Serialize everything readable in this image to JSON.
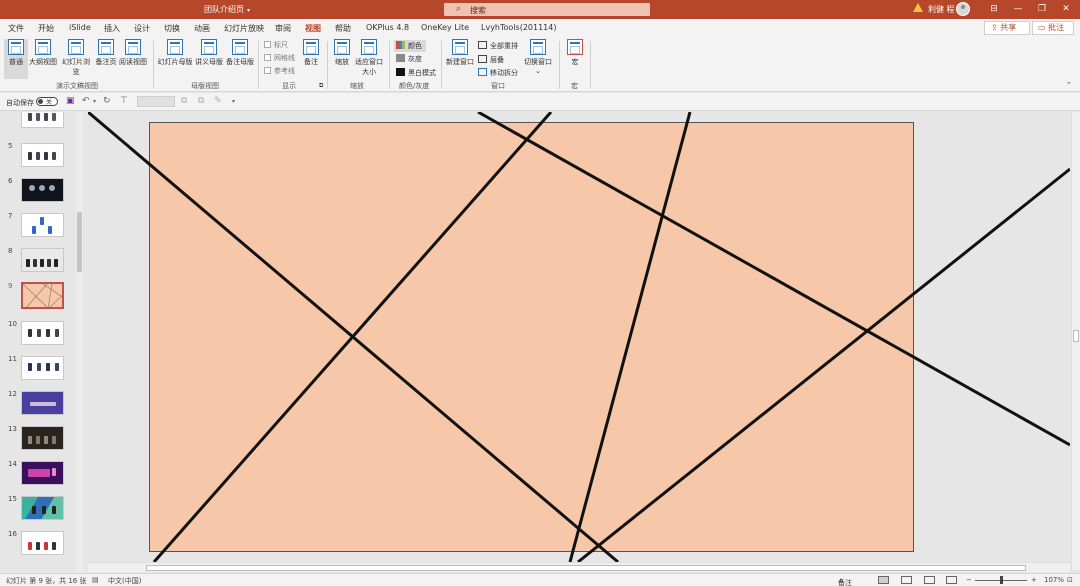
{
  "titlebar": {
    "doc_title": "团队介绍页",
    "search_placeholder": "搜索",
    "user_name": "利健 程",
    "buttons": [
      "⊟",
      "—",
      "❐",
      "✕"
    ]
  },
  "tabs": [
    "文件",
    "开始",
    "iSlide",
    "插入",
    "设计",
    "切换",
    "动画",
    "幻灯片放映",
    "审阅",
    "视图",
    "帮助",
    "OKPlus 4.8",
    "OneKey Lite",
    "LvyhTools(201114)"
  ],
  "active_tab": "视图",
  "share_label": "共享",
  "comment_label": "批注",
  "ribbon": {
    "presentation_views": {
      "items": [
        "普通",
        "大纲视图",
        "幻灯片浏览",
        "备注页",
        "阅读视图"
      ],
      "label": "演示文稿视图"
    },
    "master_views": {
      "items": [
        "幻灯片母版",
        "讲义母版",
        "备注母版"
      ],
      "label": "母版视图"
    },
    "show": {
      "checkboxes": [
        "标尺",
        "网格线",
        "参考线"
      ],
      "notes_label": "备注",
      "label": "显示"
    },
    "zoom": {
      "items": [
        "缩放",
        "适应窗口大小"
      ],
      "label": "缩放"
    },
    "color": {
      "items": [
        "颜色",
        "灰度",
        "黑白模式"
      ],
      "label": "颜色/灰度"
    },
    "window": {
      "new_window": "新建窗口",
      "items": [
        "全部重排",
        "层叠",
        "移动拆分"
      ],
      "switch_window": "切换窗口",
      "label": "窗口"
    },
    "macros": {
      "item": "宏",
      "label": "宏"
    }
  },
  "qat": {
    "autosave_label": "自动保存",
    "toggle_state": "关"
  },
  "thumbnails": [
    {
      "num": "5"
    },
    {
      "num": "6"
    },
    {
      "num": "7"
    },
    {
      "num": "8"
    },
    {
      "num": "9",
      "selected": true
    },
    {
      "num": "10"
    },
    {
      "num": "11"
    },
    {
      "num": "12"
    },
    {
      "num": "13"
    },
    {
      "num": "14"
    },
    {
      "num": "15"
    },
    {
      "num": "16"
    }
  ],
  "slide": {
    "background_color": "#f7c7aa",
    "line_color": "#111111"
  },
  "status": {
    "slide_info": "幻灯片 第 9 张，共 16 张",
    "language": "中文(中国)",
    "notes_label": "备注",
    "zoom_level": "107%"
  },
  "colors": {
    "accent": "#b7472a"
  }
}
